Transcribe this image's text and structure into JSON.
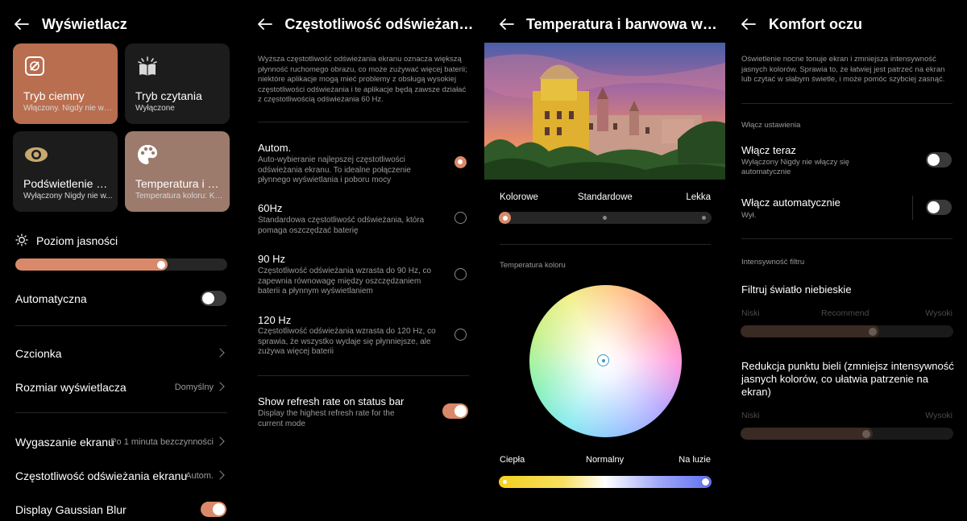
{
  "panel1": {
    "title": "Wyświetlacz",
    "tiles": [
      {
        "title": "Tryb ciemny",
        "subtitle": "Włączony. Nigdy nie wy...",
        "color": "#b86e4f"
      },
      {
        "title": "Tryb czytania",
        "subtitle": "Wyłączone",
        "color": "#1c1c1c"
      },
      {
        "title": "Podświetlenie no...",
        "subtitle": "Wyłączony Nigdy nie w...",
        "color": "#1c1c1c"
      },
      {
        "title": "Temperatura i ba...",
        "subtitle": "Temperatura koloru: Ko...",
        "color": "#9c7a6c"
      }
    ],
    "brightness_label": "Poziom jasności",
    "brightness_level": 0.72,
    "auto_label": "Automatyczna",
    "font_label": "Czcionka",
    "display_size_label": "Rozmiar wyświetlacza",
    "display_size_value": "Domyślny",
    "screen_timeout_label": "Wygaszanie ekranu",
    "screen_timeout_value": "Po 1 minuta bezczynności",
    "refresh_label": "Częstotliwość odświeżania ekranu",
    "refresh_value": "Autom.",
    "blur_label": "Display Gaussian Blur"
  },
  "panel2": {
    "title": "Częstotliwość odświeżania...",
    "intro": "Wyższa częstotliwość odświeżania ekranu oznacza większą płynność ruchomego obrazu, co może zużywać więcej baterii; niektóre aplikacje mogą mieć problemy z obsługą wysokiej częstotliwości odświeżania i te aplikacje będą zawsze działać z częstotliwością odświeżania 60 Hz.",
    "options": [
      {
        "title": "Autom.",
        "desc": "Auto-wybieranie najlepszej częstotliwości odświeżania ekranu. To idealne połączenie płynnego wyświetlania i poboru mocy"
      },
      {
        "title": "60Hz",
        "desc": "Standardowa częstotliwość odświeżania, która pomaga oszczędzać baterię"
      },
      {
        "title": "90 Hz",
        "desc": "Częstotliwość odświeżania wzrasta do 90 Hz, co zapewnia równowagę między oszczędzaniem baterii a płynnym wyświetlaniem"
      },
      {
        "title": "120 Hz",
        "desc": "Częstotliwość odświeżania wzrasta do 120 Hz, co sprawia, że wszystko wydaje się płynniejsze, ale zużywa więcej baterii"
      }
    ],
    "status_title": "Show refresh rate on status bar",
    "status_desc": "Display the highest refresh rate for the current mode"
  },
  "panel3": {
    "title": "Temperatura i barwowa w tr...",
    "mode_labels": [
      "Kolorowe",
      "Standardowe",
      "Lekka"
    ],
    "temp_section": "Temperatura koloru",
    "temp_labels": [
      "Ciepła",
      "Normalny",
      "Na luzie"
    ],
    "temp_level": 1.0
  },
  "panel4": {
    "title": "Komfort oczu",
    "intro": "Oświetlenie nocne tonuje ekran i zmniejsza intensywność jasnych kolorów. Sprawia to, że łatwiej jest patrzeć na ekran lub czytać w słabym świetle, i może pomóc szybciej zasnąć.",
    "settings_section": "Włącz ustawienia",
    "now_title": "Włącz teraz",
    "now_desc": "Wyłączony Nigdy nie włączy się automatycznie",
    "auto_title": "Włącz automatycznie",
    "auto_desc": "Wył.",
    "intensity_section": "Intensywność filtru",
    "blue_title": "Filtruj światło niebieskie",
    "blue_labels": [
      "Niski",
      "Recommend",
      "Wysoki"
    ],
    "blue_level": 0.65,
    "white_title": "Redukcja punktu bieli (zmniejsz intensywność jasnych kolorów, co ułatwia patrzenie na ekran)",
    "white_labels": [
      "Niski",
      "Wysoki"
    ],
    "white_level": 0.62
  },
  "colors": {
    "accent": "#d9896a",
    "tile_dark": "#1c1c1c",
    "track": "#262626"
  }
}
